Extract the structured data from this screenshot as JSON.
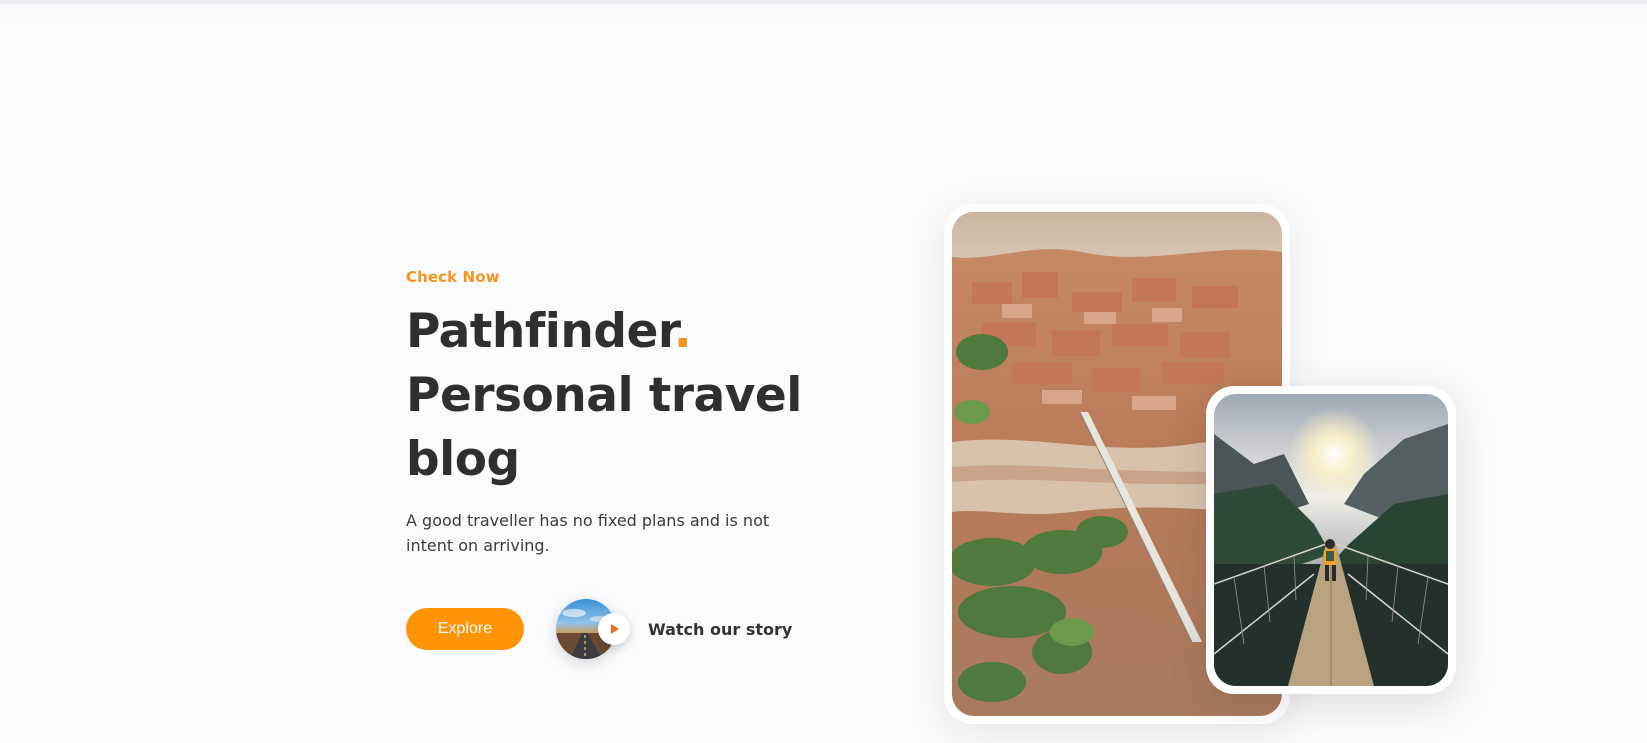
{
  "hero": {
    "eyebrow": "Check Now",
    "title_line1": "Pathfinder",
    "title_dot": ".",
    "title_line2": "Personal travel",
    "title_line3": "blog",
    "subtitle": "A good traveller has no fixed plans and is not intent on arriving."
  },
  "actions": {
    "explore_label": "Explore",
    "watch_label": "Watch our story"
  },
  "colors": {
    "accent": "#f7941d",
    "button": "#ff9505",
    "heading": "#2f2f2f",
    "background": "#fafbfd"
  },
  "icons": {
    "play": "play-icon"
  }
}
